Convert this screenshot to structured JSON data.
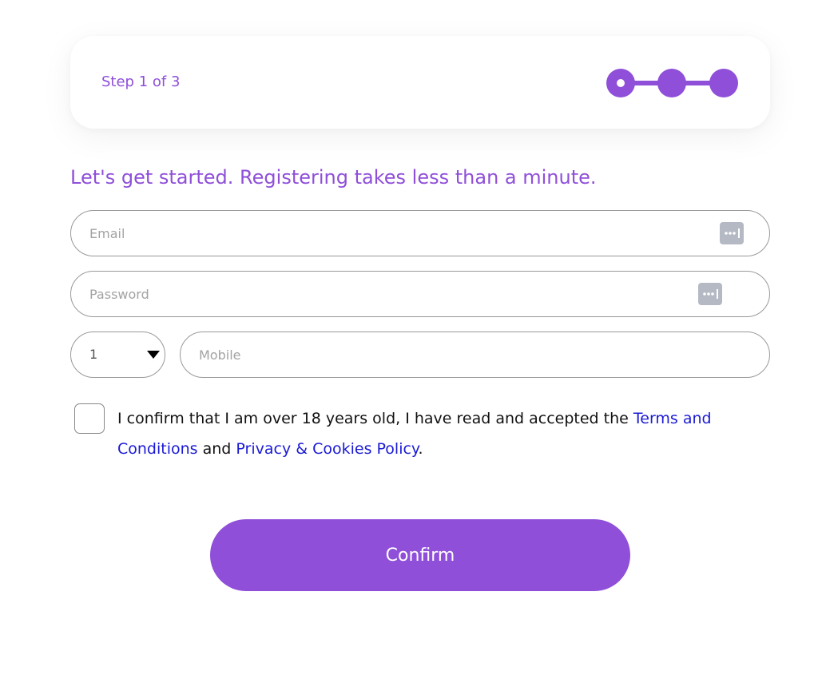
{
  "progress": {
    "label": "Step 1 of 3",
    "current_step": 1,
    "total_steps": 3
  },
  "heading": "Let's get started. Registering takes less than a minute.",
  "form": {
    "email": {
      "placeholder": "Email",
      "value": ""
    },
    "password": {
      "placeholder": "Password",
      "value": ""
    },
    "country_code": {
      "value": "1"
    },
    "mobile": {
      "placeholder": "Mobile",
      "value": ""
    }
  },
  "consent": {
    "checked": false,
    "text_before": "I confirm that I am over 18 years old, I have read and accepted the ",
    "terms_link": "Terms and Conditions",
    "text_between": " and ",
    "privacy_link": "Privacy & Cookies Policy",
    "text_after": "."
  },
  "confirm_button": {
    "label": "Confirm"
  },
  "colors": {
    "accent": "#8f4fd9",
    "link": "#1a1ad6",
    "field_border": "#999999",
    "key_icon": "#b5b9c4"
  },
  "icons": {
    "password_manager": "password-key-icon",
    "dropdown": "caret-down-icon",
    "step_current": "step-dot-current-icon",
    "step_pending": "step-dot-icon"
  }
}
